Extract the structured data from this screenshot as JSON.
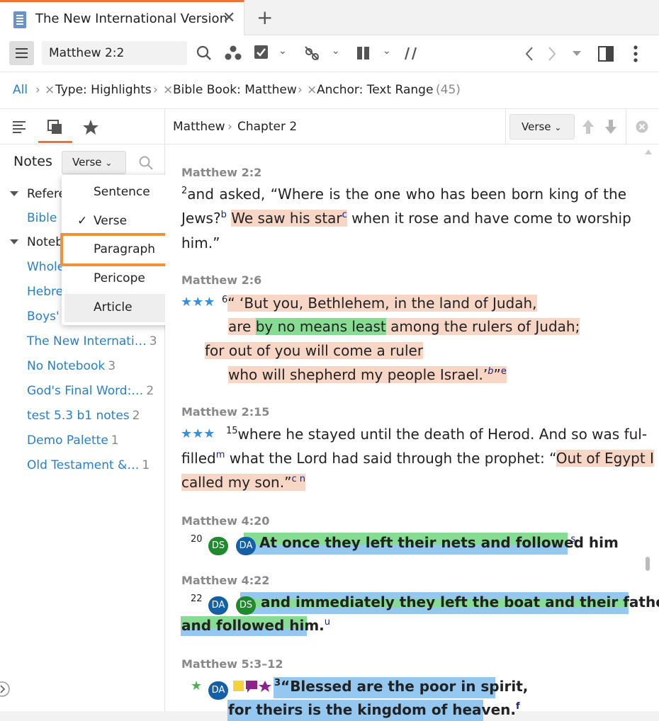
{
  "tab": {
    "title": "The New International Version",
    "close": "✕",
    "new_tab": "+"
  },
  "toolbar": {
    "reference": "Matthew 2:2"
  },
  "filters": {
    "all": "All",
    "sep": "›",
    "remove": "×",
    "type": "Type: Highlights",
    "book": "Bible Book: Matthew",
    "anchor": "Anchor: Text Range",
    "count": "(45)"
  },
  "left": {
    "notes_title": "Notes",
    "verse_dropdown": "Verse",
    "tree": [
      {
        "label": "Refere",
        "count": ""
      },
      {
        "label": "Bible",
        "count": ""
      },
      {
        "label": "Noteb",
        "count": ""
      },
      {
        "label": "Whole",
        "count": ""
      },
      {
        "label": "Hebre",
        "count": ""
      },
      {
        "label": "Boys'",
        "count": ""
      },
      {
        "label": "The New Internati…",
        "count": "3"
      },
      {
        "label": "No Notebook",
        "count": "3"
      },
      {
        "label": "God's Final Word:…",
        "count": "2"
      },
      {
        "label": "test 5.3 b1 notes",
        "count": "2"
      },
      {
        "label": "Demo Palette",
        "count": "1"
      },
      {
        "label": "Old Testament &…",
        "count": "1"
      }
    ]
  },
  "popup": {
    "options": [
      "Sentence",
      "Verse",
      "Paragraph",
      "Pericope",
      "Article"
    ],
    "checked": "✓"
  },
  "content": {
    "crumb_book": "Matthew",
    "crumb_sep": "›",
    "crumb_chapter": "Chapter 2",
    "verse_dropdown": "Verse",
    "entries": [
      {
        "head": "Matthew 2:2"
      },
      {
        "head": "Matthew 2:6"
      },
      {
        "head": "Matthew 2:15"
      },
      {
        "head": "Matthew 4:20"
      },
      {
        "head": "Matthew 4:22"
      },
      {
        "head": "Matthew 5:3–12"
      }
    ],
    "t": {
      "v2_num": "2",
      "v2_a": "and asked, “Where is the one who has been born king of the",
      "v2_b1": "Jews?",
      "v2_b_sup1": "b",
      "v2_b2": "We saw his star",
      "v2_b_sup2": "c",
      "v2_b3": " when it rose and have come to worship",
      "v2_c": "him.”",
      "v6_num": "6",
      "v6_a": "“ ‘But you, Bethlehem, in the land of Judah,",
      "v6_b1": "are ",
      "v6_b2": "by no means least",
      "v6_b3": " among the rulers of Judah;",
      "v6_c": "for out of you will come a ruler",
      "v6_d": "who will shepherd my people Israel.’",
      "v6_d_sup1": "b",
      "v6_d_q": "”",
      "v6_d_sup2": "e",
      "v15_num": "15",
      "v15_a": "where he stayed until the death of Herod. And so was ful-",
      "v15_b1": "filled",
      "v15_b_sup": "m",
      "v15_b2": " what the Lord had said through the prophet: “",
      "v15_b3": "Out of Egypt I",
      "v15_c": "called my son.”",
      "v15_c_sup": "c n",
      "v420_num": "20",
      "v420_text": "At once they left their nets and followed him",
      "v420_end": ".",
      "v420_sup": "s",
      "v422_num": "22",
      "v422_a": "and immediately they left the boat and their father",
      "v422_b": "and followed him.",
      "v422_sup": "u",
      "v53_num": "3",
      "v53_a": "“Blessed are the poor in spirit,",
      "v53_b": "for theirs is the kingdom of heaven.",
      "v53_sup": "f",
      "av_ds": "DS",
      "av_da": "DA",
      "stars": "★★★",
      "star": "★"
    }
  }
}
